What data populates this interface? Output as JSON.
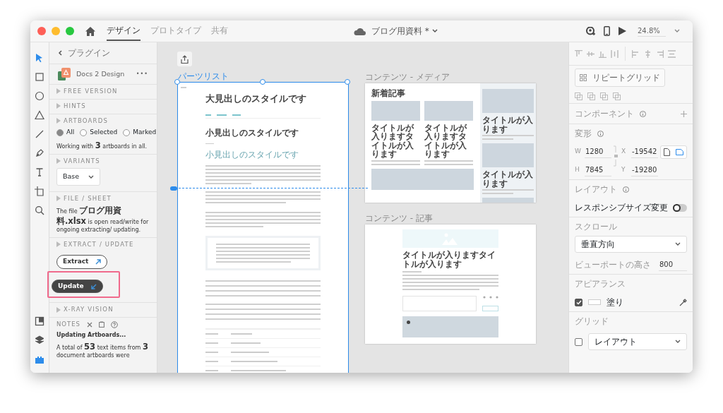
{
  "titlebar": {
    "tabs": [
      {
        "label": "デザイン",
        "selected": true
      },
      {
        "label": "プロトタイプ",
        "selected": false
      },
      {
        "label": "共有",
        "selected": false
      }
    ],
    "document_title": "ブログ用資料 *",
    "zoom": "24.8%"
  },
  "tools": [
    {
      "kind": "select",
      "selected": true
    },
    {
      "kind": "rectangle",
      "selected": false
    },
    {
      "kind": "ellipse",
      "selected": false
    },
    {
      "kind": "triangle",
      "selected": false
    },
    {
      "kind": "line",
      "selected": false
    },
    {
      "kind": "pen",
      "selected": false
    },
    {
      "kind": "text",
      "selected": false
    },
    {
      "kind": "artboard",
      "selected": false
    },
    {
      "kind": "zoom",
      "selected": false
    }
  ],
  "bottom_tools": [
    {
      "kind": "assets",
      "selected": false
    },
    {
      "kind": "layers",
      "selected": false
    },
    {
      "kind": "plugins",
      "selected": true
    }
  ],
  "plugin_panel": {
    "back_label": "プラグイン",
    "plugin_name": "Docs 2 Design",
    "more": "•••",
    "sections": [
      {
        "kind": "header",
        "title": "FREE VERSION"
      },
      {
        "kind": "header",
        "title": "HINTS"
      },
      {
        "kind": "artboards",
        "title": "ARTBOARDS",
        "options": [
          {
            "label": "All",
            "selected": true
          },
          {
            "label": "Selected",
            "selected": false
          },
          {
            "label": "Marked",
            "selected": false
          }
        ],
        "note": "Working with **3** artboards in all."
      },
      {
        "kind": "variants",
        "title": "VARIANTS",
        "value": "Base"
      },
      {
        "kind": "file",
        "title": "FILE / SHEET",
        "text": "The file **ブログ用資料.xlsx** is open read/write for ongoing extracting/ updating."
      },
      {
        "kind": "extract",
        "title": "EXTRACT / UPDATE",
        "buttons": [
          {
            "label": "Extract",
            "filled": false,
            "highlighted": false
          },
          {
            "label": "Update",
            "filled": true,
            "highlighted": true
          }
        ]
      },
      {
        "kind": "header",
        "title": "X-RAY VISION"
      },
      {
        "kind": "notes",
        "title": "NOTES",
        "heading": "Updating Artboards...",
        "text": "A total of **53** text items from **3** document artboards were"
      }
    ]
  },
  "canvas": {
    "artboards": [
      {
        "kind": "parts",
        "name": "パーツリスト",
        "selected": true,
        "heading": "大見出しのスタイルです",
        "subheading": "小見出しのスタイルです",
        "minor_heading": "小見出しのスタイルです"
      },
      {
        "kind": "media",
        "name": "コンテンツ - メディア",
        "selected": false,
        "section_title": "新着記事",
        "card_titles": [
          "タイトルが入りますタイトルが入ります",
          "タイトルが入りますタイトルが入ります"
        ],
        "side_titles": [
          "タイトルが入ります",
          "タイトルが入ります"
        ]
      },
      {
        "kind": "article",
        "name": "コンテンツ - 記事",
        "selected": false,
        "title": "タイトルが入りますタイトルが入ります"
      }
    ]
  },
  "properties": {
    "repeat_grid": "リピートグリッド",
    "component_label": "コンポーネント",
    "transform_label": "変形",
    "fields": [
      {
        "label": "W",
        "value": "1280"
      },
      {
        "label": "X",
        "value": "-19542"
      },
      {
        "label": "H",
        "value": "7845"
      },
      {
        "label": "Y",
        "value": "-19280"
      }
    ],
    "orientation": [
      {
        "kind": "portrait",
        "selected": false
      },
      {
        "kind": "landscape",
        "selected": true
      }
    ],
    "layout_label": "レイアウト",
    "responsive_label": "レスポンシブサイズ変更",
    "responsive_on": false,
    "scroll_label": "スクロール",
    "scroll_value": "垂直方向",
    "viewport_label": "ビューポートの高さ",
    "viewport_value": "800",
    "appearance_label": "アピアランス",
    "fill_on": true,
    "fill_label": "塗り",
    "grid_label": "グリッド",
    "grid_on": false,
    "grid_value": "レイアウト"
  }
}
